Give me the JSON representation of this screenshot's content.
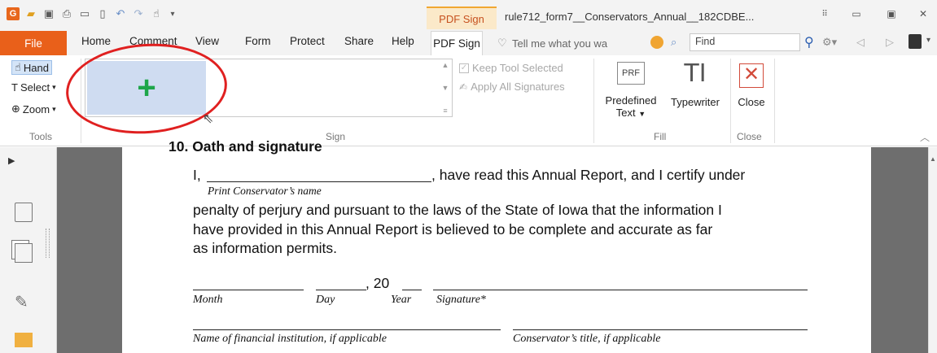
{
  "titlebar": {
    "context_tab": "PDF Sign",
    "document_title": "rule712_form7__Conservators_Annual__182CDBE..."
  },
  "tabs": {
    "file": "File",
    "items": [
      "Home",
      "Comment",
      "View",
      "Form",
      "Protect",
      "Share",
      "Help"
    ],
    "active": "PDF Sign",
    "tell_me": "Tell me what you wa",
    "find": "Find"
  },
  "ribbon": {
    "tools": {
      "hand": "Hand",
      "select": "Select",
      "zoom": "Zoom",
      "group_label": "Tools"
    },
    "sign": {
      "group_label": "Sign",
      "keep_tool": "Keep Tool Selected",
      "apply_all": "Apply All Signatures"
    },
    "fill": {
      "predefined": "Predefined",
      "predefined_sub": "Text",
      "typewriter": "Typewriter",
      "group_label": "Fill",
      "prf_icon_text": "PRF"
    },
    "close": {
      "label": "Close",
      "group_label": "Close"
    }
  },
  "document": {
    "heading": "10. Oath and signature",
    "line1_prefix": "I, ",
    "line1_suffix": ", have read this Annual Report, and I certify under",
    "print_name": "Print Conservator’s name",
    "para_line2": "penalty of perjury and pursuant to the laws of the State of Iowa that the information I",
    "para_line3": "have provided in this Annual Report is believed to be complete and accurate as far",
    "para_line4": "as information permits.",
    "year_prefix": ", 20",
    "month": "Month",
    "day": "Day",
    "year": "Year",
    "signature": "Signature*",
    "financial": "Name of financial institution, if applicable",
    "cons_title": "Conservator’s title, if applicable"
  },
  "colors": {
    "accent": "#e9601a",
    "sign_tab_bg": "#fbe9c9",
    "sign_tile": "#cfdcf1",
    "plus": "#1ea64a",
    "annotation": "#e02020"
  }
}
